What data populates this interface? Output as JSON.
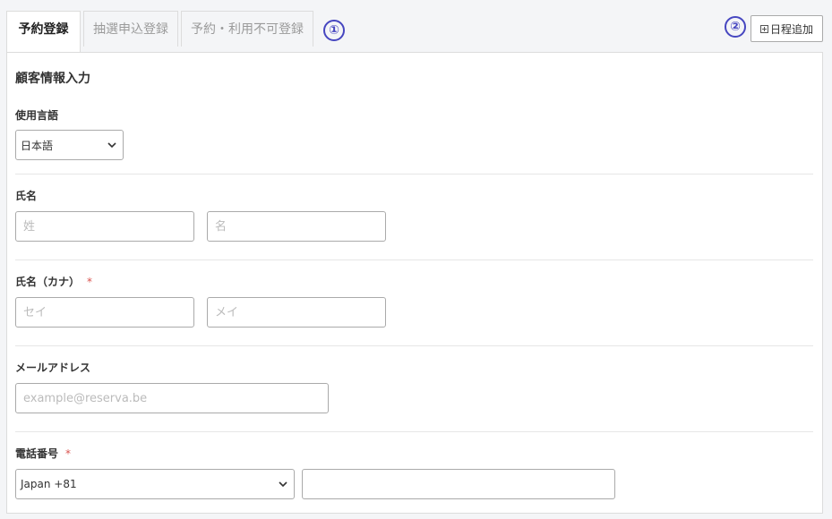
{
  "tabs": [
    {
      "label": "予約登録",
      "active": true
    },
    {
      "label": "抽選申込登録",
      "active": false
    },
    {
      "label": "予約・利用不可登録",
      "active": false
    }
  ],
  "markers": {
    "one": "①",
    "two": "②"
  },
  "add_date_button": {
    "label": "日程追加",
    "icon": "plus-square-icon"
  },
  "form": {
    "title": "顧客情報入力",
    "language": {
      "label": "使用言語",
      "selected": "日本語"
    },
    "name": {
      "label": "氏名",
      "last_placeholder": "姓",
      "first_placeholder": "名"
    },
    "kana": {
      "label": "氏名（カナ）",
      "required": "*",
      "last_placeholder": "セイ",
      "first_placeholder": "メイ"
    },
    "email": {
      "label": "メールアドレス",
      "placeholder": "example@reserva.be"
    },
    "phone": {
      "label": "電話番号",
      "required": "*",
      "country_selected": "Japan +81",
      "number_value": ""
    }
  },
  "colors": {
    "accent": "#4646c0",
    "required": "#d9534f"
  }
}
